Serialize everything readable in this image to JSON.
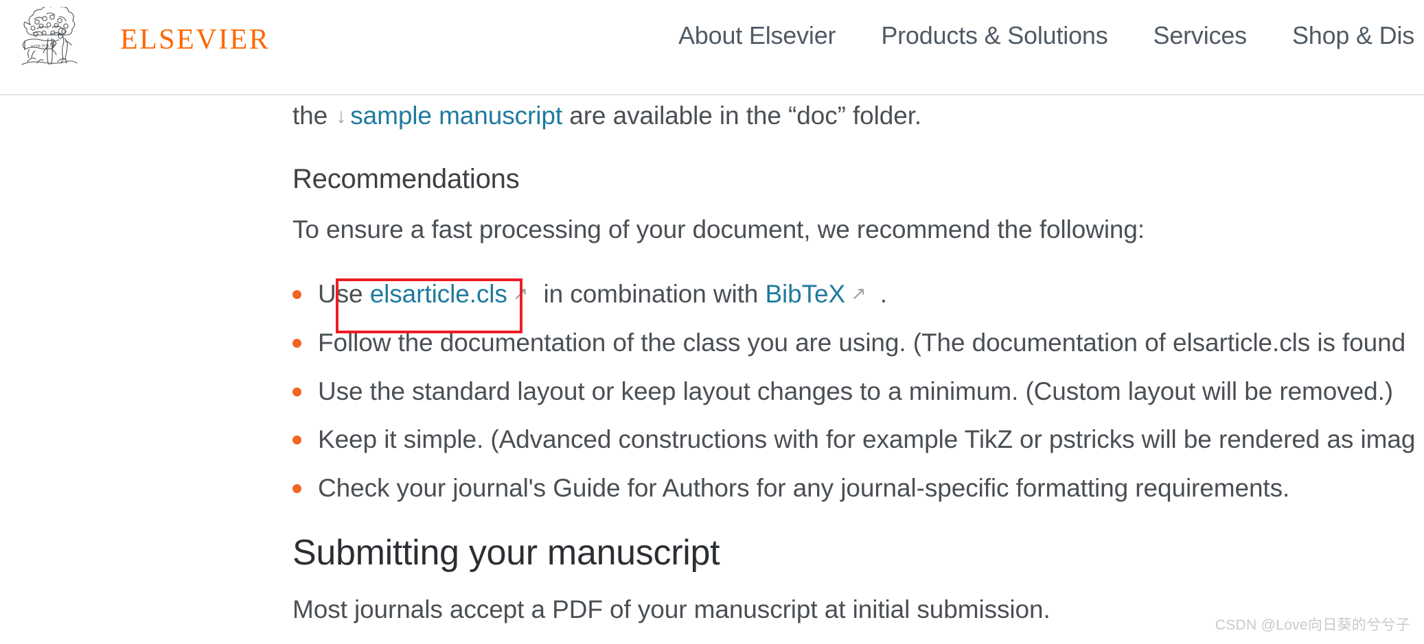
{
  "header": {
    "brand_name": "ELSEVIER",
    "brand_motto": "NON SOLUS",
    "brand_color": "#ff6600",
    "nav": [
      {
        "label": "About Elsevier"
      },
      {
        "label": "Products & Solutions"
      },
      {
        "label": "Services"
      },
      {
        "label": "Shop & Dis"
      }
    ]
  },
  "content": {
    "intro_line": {
      "before": "the",
      "download_icon": "arrow-down-icon",
      "link": "sample manuscript",
      "after": "are available in the “doc” folder."
    },
    "recommendations": {
      "heading": "Recommendations",
      "lead": "To ensure a fast processing of your document, we recommend the following:",
      "items": [
        {
          "prefix": "Use",
          "link1": "elsarticle.cls",
          "ext_icon": "external-link-icon",
          "middle": "in combination with",
          "link2": "BibTeX",
          "ext_icon2": "external-link-icon",
          "suffix": "."
        },
        {
          "text": "Follow the documentation of the class you are using. (The documentation of elsarticle.cls is found"
        },
        {
          "text": "Use the standard layout or keep layout changes to a minimum. (Custom layout will be removed.)"
        },
        {
          "text": "Keep it simple. (Advanced constructions with for example TikZ or pstricks will be rendered as imag"
        },
        {
          "text": "Check your journal's Guide for Authors for any journal-specific formatting requirements."
        }
      ]
    },
    "submitting": {
      "heading": "Submitting your manuscript",
      "paragraph": "Most journals accept a PDF of your manuscript at initial submission."
    },
    "annotation": {
      "type": "red-rectangle-highlight",
      "color": "#ee1c25",
      "targets": "elsarticle.cls"
    }
  },
  "watermark": {
    "text": "CSDN @Love向日葵的兮兮子"
  }
}
